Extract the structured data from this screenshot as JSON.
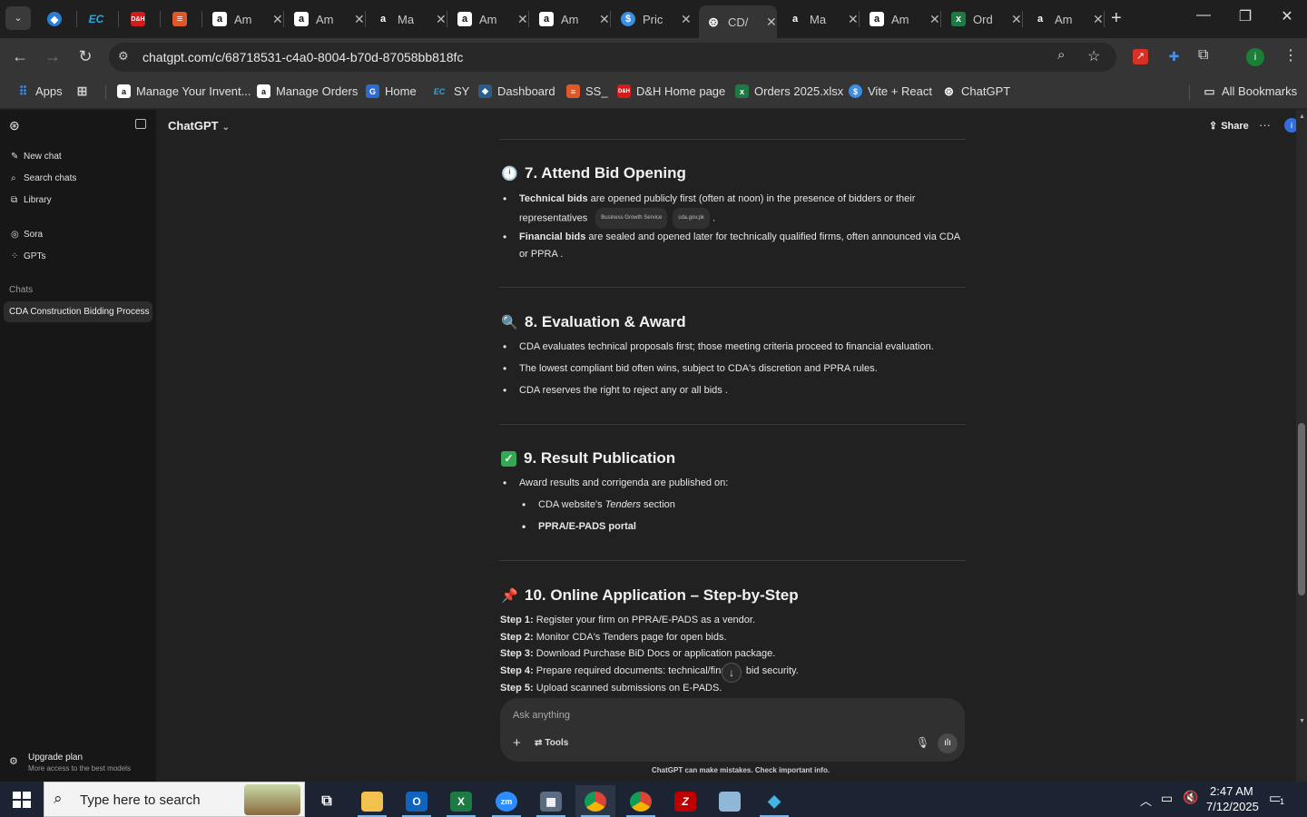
{
  "browser": {
    "tabs": [
      {
        "label": "",
        "icon": "app-icon"
      },
      {
        "label": "",
        "icon": "ec-icon"
      },
      {
        "label": "",
        "icon": "dh-icon"
      },
      {
        "label": "",
        "icon": "stack-icon"
      },
      {
        "label": "Am",
        "icon": "amazon-icon"
      },
      {
        "label": "Am",
        "icon": "amazon-icon"
      },
      {
        "label": "Ma",
        "icon": "amazon-icon"
      },
      {
        "label": "Am",
        "icon": "amazon-icon"
      },
      {
        "label": "Am",
        "icon": "amazon-icon"
      },
      {
        "label": "Pric",
        "icon": "dollar-icon"
      },
      {
        "label": "CD/",
        "icon": "chatgpt-icon",
        "active": true
      },
      {
        "label": "Ma",
        "icon": "amazon-icon"
      },
      {
        "label": "Am",
        "icon": "amazon-icon"
      },
      {
        "label": "Ord",
        "icon": "excel-icon"
      },
      {
        "label": "Am",
        "icon": "amazon-icon"
      }
    ],
    "url": "chatgpt.com/c/68718531-c4a0-8004-b70d-87058bb818fc",
    "bookmarks": [
      {
        "label": "Apps",
        "icon": "apps-grid-icon"
      },
      {
        "label": "",
        "icon": "tab-groups-icon"
      },
      {
        "label": "Manage Your Invent...",
        "icon": "amazon-icon"
      },
      {
        "label": "Manage Orders",
        "icon": "amazon-icon"
      },
      {
        "label": "Home",
        "icon": "home-g-icon"
      },
      {
        "label": "SY",
        "icon": "ec-icon"
      },
      {
        "label": "Dashboard",
        "icon": "dashboard-icon"
      },
      {
        "label": "SS_",
        "icon": "stack-icon"
      },
      {
        "label": "D&H Home page",
        "icon": "dh-icon"
      },
      {
        "label": "Orders 2025.xlsx",
        "icon": "excel-icon"
      },
      {
        "label": "Vite + React",
        "icon": "dollar-icon"
      },
      {
        "label": "ChatGPT",
        "icon": "chatgpt-icon"
      }
    ],
    "all_bookmarks": "All Bookmarks"
  },
  "sidebar": {
    "new_chat": "New chat",
    "search_chats": "Search chats",
    "library": "Library",
    "sora": "Sora",
    "gpts": "GPTs",
    "chats_heading": "Chats",
    "active_chat": "CDA Construction Bidding Process",
    "upgrade_title": "Upgrade plan",
    "upgrade_sub": "More access to the best models"
  },
  "header": {
    "model": "ChatGPT",
    "share": "Share"
  },
  "content": {
    "s7_title": "7. Attend Bid Opening",
    "s7_b1_bold": "Technical bids",
    "s7_b1_rest": " are opened publicly first (often at noon) in the presence of bidders or their representatives",
    "s7_chip1": "Business Growth Service",
    "s7_chip2": "cda.gov.pk",
    "s7_b2_bold": "Financial bids",
    "s7_b2_rest": " are sealed and opened later for technically qualified firms, often announced via CDA or PPRA .",
    "s8_title": "8. Evaluation & Award",
    "s8_b1": "CDA evaluates technical proposals first; those meeting criteria proceed to financial evaluation.",
    "s8_b2": "The lowest compliant bid often wins, subject to CDA's discretion and PPRA rules.",
    "s8_b3": "CDA reserves the right to reject any or all bids .",
    "s9_title": "9. Result Publication",
    "s9_b1": "Award results and corrigenda are published on:",
    "s9_b1a_pre": "CDA website's ",
    "s9_b1a_em": "Tenders",
    "s9_b1a_post": " section",
    "s9_b1b": "PPRA/E-PADS portal",
    "s10_title": "10. Online Application – Step-by-Step",
    "steps": [
      {
        "label": "Step 1:",
        "text": " Register your firm on PPRA/E-PADS as a vendor."
      },
      {
        "label": "Step 2:",
        "text": " Monitor CDA's Tenders page for open bids."
      },
      {
        "label": "Step 3:",
        "text": " Download Purchase BiD Docs or application package."
      },
      {
        "label": "Step 4:",
        "text": " Prepare required documents: technical/finan     bid security."
      },
      {
        "label": "Step 5:",
        "text": " Upload scanned submissions on E-PADS."
      }
    ]
  },
  "composer": {
    "placeholder": "Ask anything",
    "tools": "Tools",
    "disclaimer": "ChatGPT can make mistakes. Check important info."
  },
  "taskbar": {
    "search_placeholder": "Type here to search",
    "time": "2:47 AM",
    "date": "7/12/2025",
    "notifications": "1"
  }
}
